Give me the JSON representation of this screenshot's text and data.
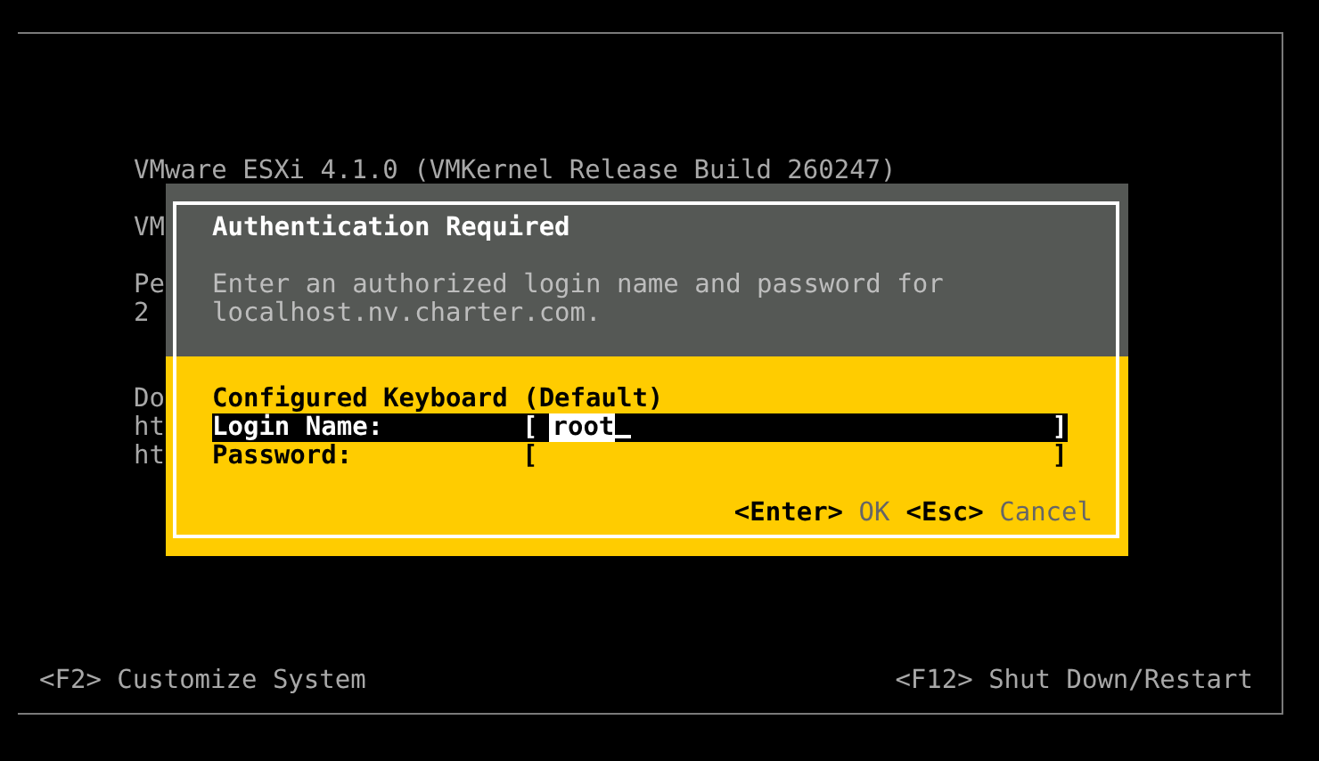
{
  "background_lines": [
    [
      "VMware ESXi 4.1.0 (VMKernel Release Build 260247)"
    ],
    [
      "VM"
    ],
    [
      "Pe",
      "2"
    ],
    [
      "Do",
      "ht",
      "ht"
    ]
  ],
  "dialog": {
    "title": "Authentication Required",
    "description": [
      "Enter an authorized login name and password for",
      "localhost.nv.charter.com."
    ],
    "keyboard_label": "Configured Keyboard (Default)",
    "fields": [
      {
        "label": "Login Name:",
        "bracket_left": "[",
        "value": "root",
        "bracket_right": "]",
        "selected": true
      },
      {
        "label": "Password:",
        "bracket_left": "[",
        "bracket_right": "]",
        "selected": false
      }
    ],
    "actions": [
      {
        "key": "<Enter>",
        "label": "OK"
      },
      {
        "key": "<Esc>",
        "label": "Cancel"
      }
    ]
  },
  "footer": {
    "left": "<F2> Customize System",
    "right": "<F12> Shut Down/Restart"
  }
}
